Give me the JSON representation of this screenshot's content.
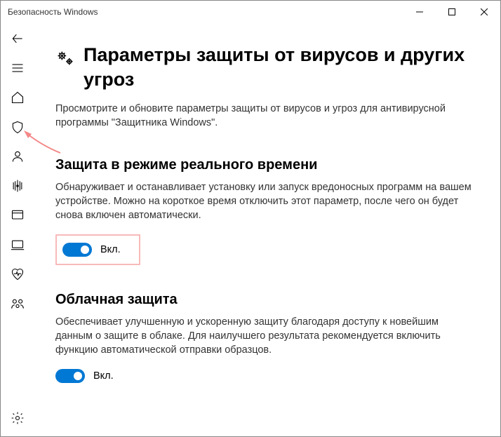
{
  "window": {
    "title": "Безопасность Windows"
  },
  "page": {
    "heading": "Параметры защиты от вирусов и других угроз",
    "description": "Просмотрите и обновите параметры защиты от вирусов и угроз для антивирусной программы \"Защитника Windows\"."
  },
  "sections": {
    "realtime": {
      "title": "Защита в режиме реального времени",
      "desc": "Обнаруживает и останавливает установку или запуск вредоносных программ на вашем устройстве. Можно на короткое время отключить этот параметр, после чего он будет снова включен автоматически.",
      "toggle_label": "Вкл."
    },
    "cloud": {
      "title": "Облачная защита",
      "desc": "Обеспечивает улучшенную и ускоренную защиту благодаря доступу к новейшим данным о защите в облаке. Для наилучшего результата рекомендуется включить функцию автоматической отправки образцов.",
      "toggle_label": "Вкл."
    }
  }
}
